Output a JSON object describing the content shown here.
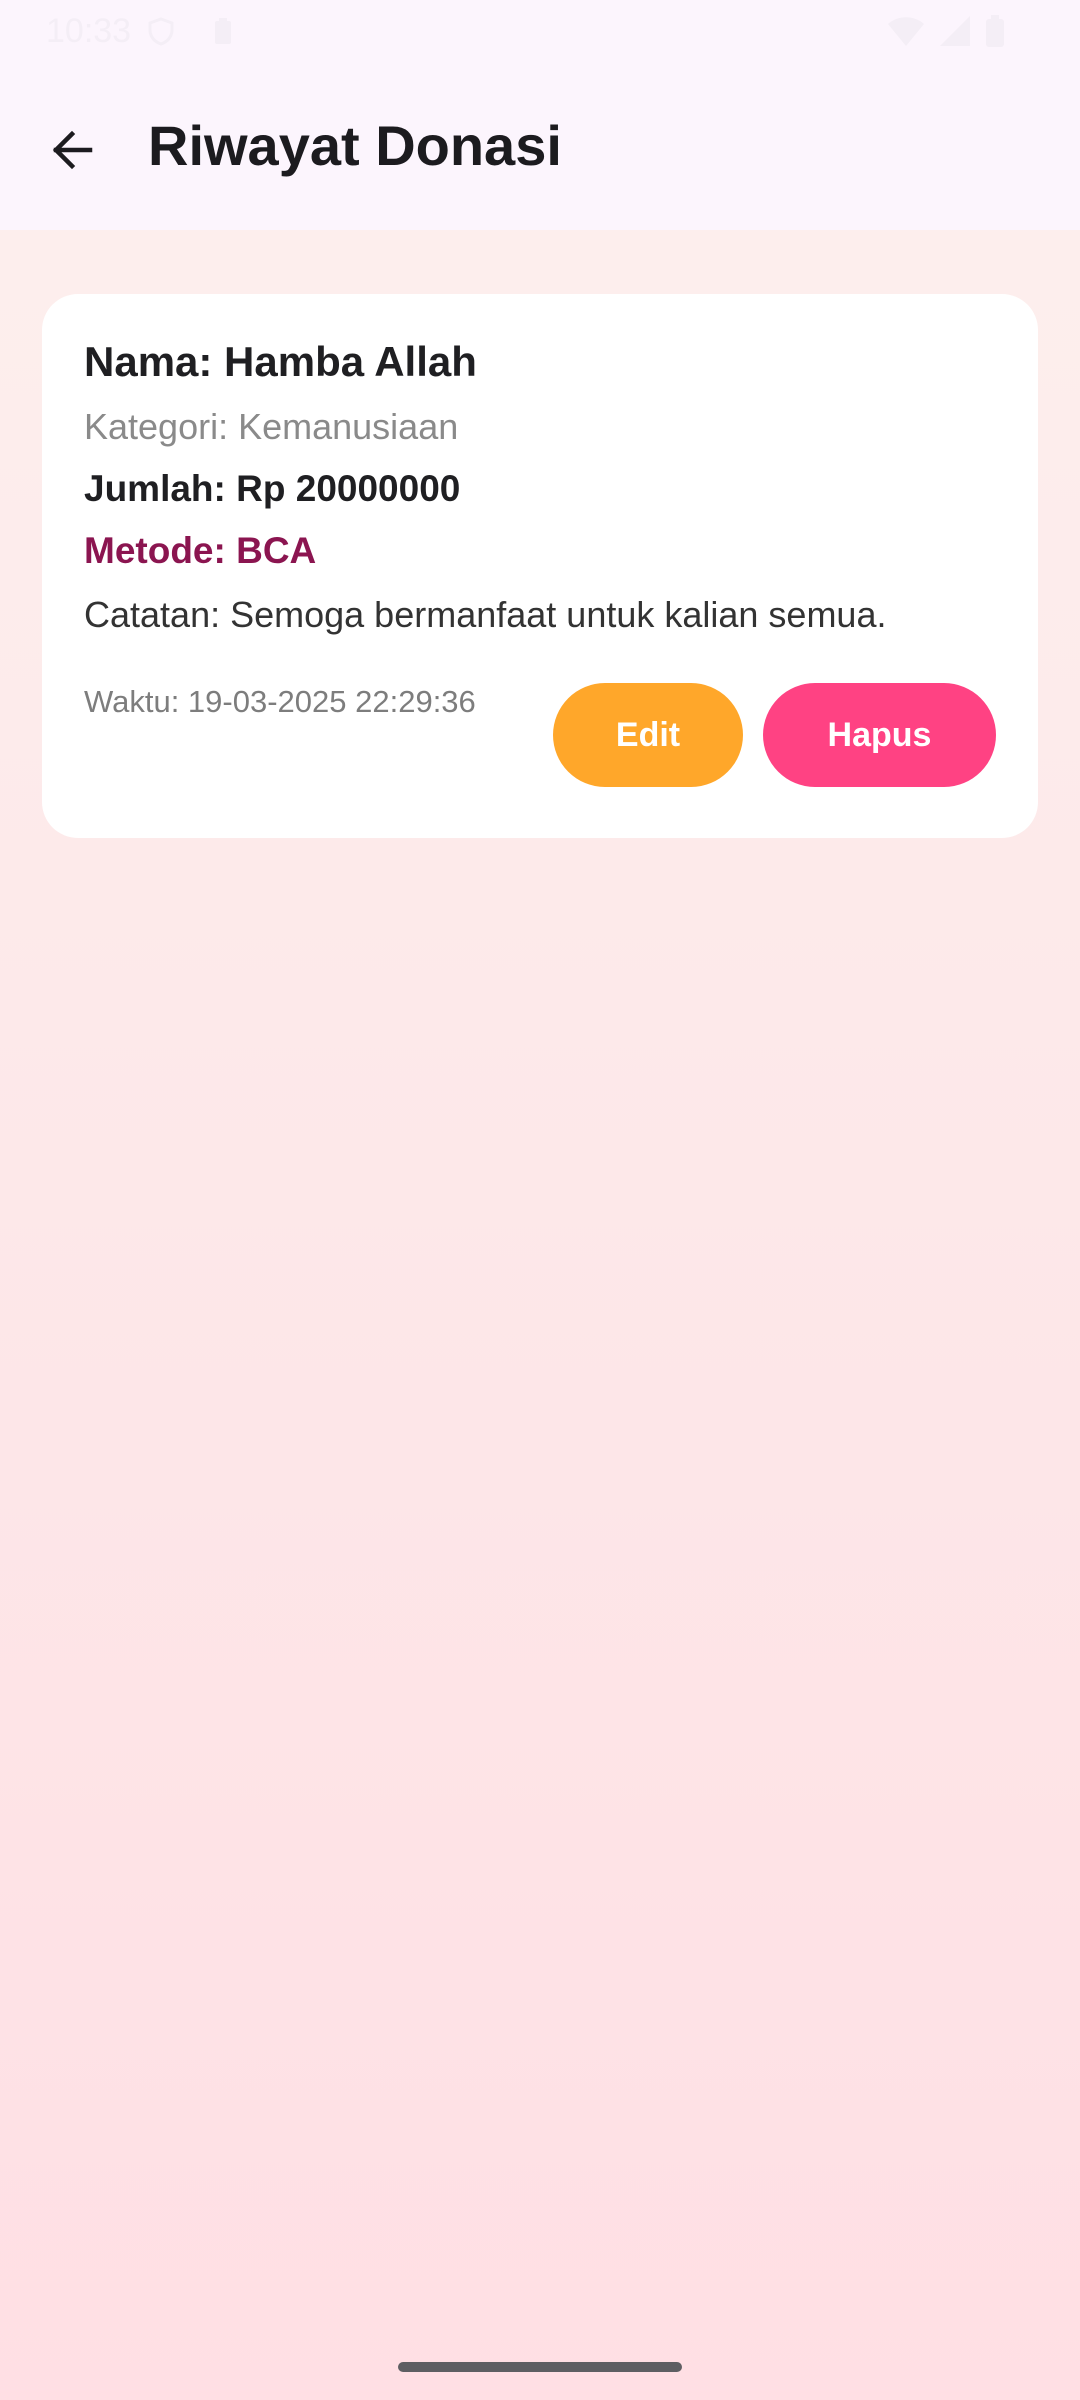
{
  "status_bar": {
    "time": "10:33",
    "icons": [
      "vpn-icon",
      "battery-saver-icon",
      "wifi-icon",
      "cell-signal-icon",
      "battery-icon"
    ]
  },
  "app_bar": {
    "title": "Riwayat Donasi",
    "back_icon": "arrow-back-icon"
  },
  "donations": [
    {
      "name": "Nama: Hamba Allah",
      "category": "Kategori: Kemanusiaan",
      "amount": "Jumlah: Rp 20000000",
      "method": "Metode: BCA",
      "note": "Catatan: Semoga bermanfaat untuk kalian semua.",
      "time": "Waktu: 19-03-2025 22:29:36",
      "edit_label": "Edit",
      "delete_label": "Hapus"
    }
  ],
  "colors": {
    "app_bar_bg": "#fcf5fd",
    "method_text": "#8b1550",
    "edit_button": "#ffa72a",
    "delete_button": "#ff4283",
    "card_bg": "#ffffff"
  }
}
